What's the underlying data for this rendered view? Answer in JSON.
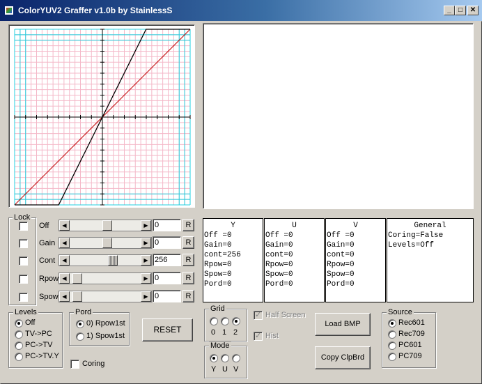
{
  "window": {
    "title": "ColorYUV2 Graffer v1.0b by StainlessS",
    "controls": {
      "minimize": "_",
      "maximize": "□",
      "close": "✕"
    }
  },
  "lock": {
    "label": "Lock",
    "rows": [
      {
        "label": "Off",
        "value": "0",
        "locked": false,
        "position": 0.53
      },
      {
        "label": "Gain",
        "value": "0",
        "locked": false,
        "position": 0.53
      },
      {
        "label": "Cont",
        "value": "256",
        "locked": false,
        "position": 0.62
      },
      {
        "label": "Rpow",
        "value": "0",
        "locked": false,
        "position": 0.05
      },
      {
        "label": "Spow",
        "value": "0",
        "locked": false,
        "position": 0.05
      }
    ],
    "reset_label": "R"
  },
  "info": {
    "Y": {
      "title": "Y",
      "lines": [
        "Off =0",
        "Gain=0",
        "cont=256",
        "Rpow=0",
        "Spow=0",
        "Pord=0"
      ]
    },
    "U": {
      "title": "U",
      "lines": [
        "Off =0",
        "Gain=0",
        "cont=0",
        "Rpow=0",
        "Spow=0",
        "Pord=0"
      ]
    },
    "V": {
      "title": "V",
      "lines": [
        "Off =0",
        "Gain=0",
        "cont=0",
        "Rpow=0",
        "Spow=0",
        "Pord=0"
      ]
    },
    "general": {
      "title": "General",
      "lines": [
        "Coring=False",
        "Levels=Off"
      ]
    }
  },
  "levels": {
    "label": "Levels",
    "options": [
      "Off",
      "TV->PC",
      "PC->TV",
      "PC->TV.Y"
    ],
    "selected": 0
  },
  "pord": {
    "label": "Pord",
    "options": [
      "0) Rpow1st",
      "1) Spow1st"
    ],
    "selected": 0
  },
  "reset_button": "RESET",
  "coring": {
    "label": "Coring",
    "checked": false
  },
  "grid": {
    "label": "Grid",
    "options": [
      "0",
      "1",
      "2"
    ],
    "selected": 2
  },
  "mode": {
    "label": "Mode",
    "options": [
      "Y",
      "U",
      "V"
    ],
    "selected": 0
  },
  "half_screen": {
    "label": "Half Screen",
    "checked": true
  },
  "hist": {
    "label": "Hist",
    "checked": true
  },
  "load_bmp": "Load BMP",
  "copy_clipboard": "Copy ClpBrd",
  "source": {
    "label": "Source",
    "options": [
      "Rec601",
      "Rec709",
      "PC601",
      "PC709"
    ],
    "selected": 0
  },
  "colors": {
    "minor_grid": "#f4b8c8",
    "major_grid": "#22d0e0",
    "curve": "#000000",
    "identity": "#c00000"
  }
}
